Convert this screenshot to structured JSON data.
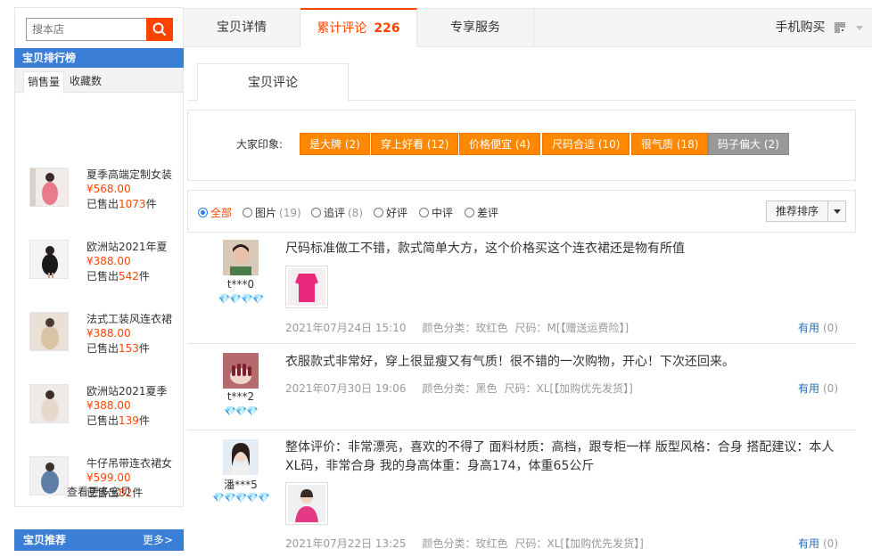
{
  "search": {
    "placeholder": "搜本店"
  },
  "ranking": {
    "title": "宝贝排行榜",
    "tabs": [
      "销售量",
      "收藏数"
    ],
    "sold_prefix": "已售出",
    "sold_suffix": "件",
    "items": [
      {
        "name": "夏季高端定制女装",
        "price": "¥568.00",
        "sold": "1073"
      },
      {
        "name": "欧洲站2021年夏",
        "price": "¥388.00",
        "sold": "542"
      },
      {
        "name": "法式工装风连衣裙",
        "price": "¥388.00",
        "sold": "153"
      },
      {
        "name": "欧洲站2021夏季",
        "price": "¥388.00",
        "sold": "139"
      },
      {
        "name": "牛仔吊带连衣裙女",
        "price": "¥599.00",
        "sold": "82"
      }
    ],
    "more": "查看更多宝贝"
  },
  "recommend": {
    "title": "宝贝推荐",
    "more": "更多>"
  },
  "tabs": [
    {
      "label": "宝贝详情",
      "count": ""
    },
    {
      "label": "累计评论",
      "count": "226"
    },
    {
      "label": "专享服务",
      "count": ""
    }
  ],
  "mobile_buy": "手机购买",
  "subtab": "宝贝评论",
  "impression": {
    "label": "大家印象:",
    "tags": [
      {
        "text": "是大牌 (2)",
        "type": "pos"
      },
      {
        "text": "穿上好看 (12)",
        "type": "pos"
      },
      {
        "text": "价格便宜 (4)",
        "type": "pos"
      },
      {
        "text": "尺码合适 (10)",
        "type": "pos"
      },
      {
        "text": "很气质 (18)",
        "type": "pos"
      },
      {
        "text": "码子偏大 (2)",
        "type": "neg"
      }
    ]
  },
  "filter": {
    "options": [
      {
        "label": "全部",
        "count": ""
      },
      {
        "label": "图片",
        "count": "(19)"
      },
      {
        "label": "追评",
        "count": "(8)"
      },
      {
        "label": "好评",
        "count": ""
      },
      {
        "label": "中评",
        "count": ""
      },
      {
        "label": "差评",
        "count": ""
      }
    ],
    "sort": "推荐排序"
  },
  "reviews": [
    {
      "nick": "t***0",
      "level": "💎💎💎💎",
      "text": "尺码标准做工不错，款式简单大方，这个价格买这个连衣裙还是物有所值",
      "date": "2021年07月24日 15:10",
      "color": "颜色分类：玫红色",
      "size": "尺码：M[【赠送运费险】]",
      "useful": "有用",
      "useful_count": "(0)"
    },
    {
      "nick": "t***2",
      "level": "💎💎💎",
      "text": "衣服款式非常好，穿上很显瘦又有气质！很不错的一次购物，开心！下次还回来。",
      "date": "2021年07月30日 19:06",
      "color": "颜色分类：黑色",
      "size": "尺码：XL[【加购优先发货】]",
      "useful": "有用",
      "useful_count": "(0)"
    },
    {
      "nick": "潘***5",
      "level": "💎💎💎💎💎",
      "text": "整体评价：非常漂亮，喜欢的不得了 面料材质：高档，跟专柜一样 版型风格：合身 搭配建议：本人XL码，非常合身 我的身高体重：身高174，体重65公斤",
      "date": "2021年07月22日 13:25",
      "color": "颜色分类：玫红色",
      "size": "尺码：XL[【加购优先发货】]",
      "useful": "有用",
      "useful_count": "(0)"
    }
  ],
  "colors": {
    "accent": "#ff4400",
    "tag": "#ff8800",
    "blue": "#3b7ed6"
  }
}
